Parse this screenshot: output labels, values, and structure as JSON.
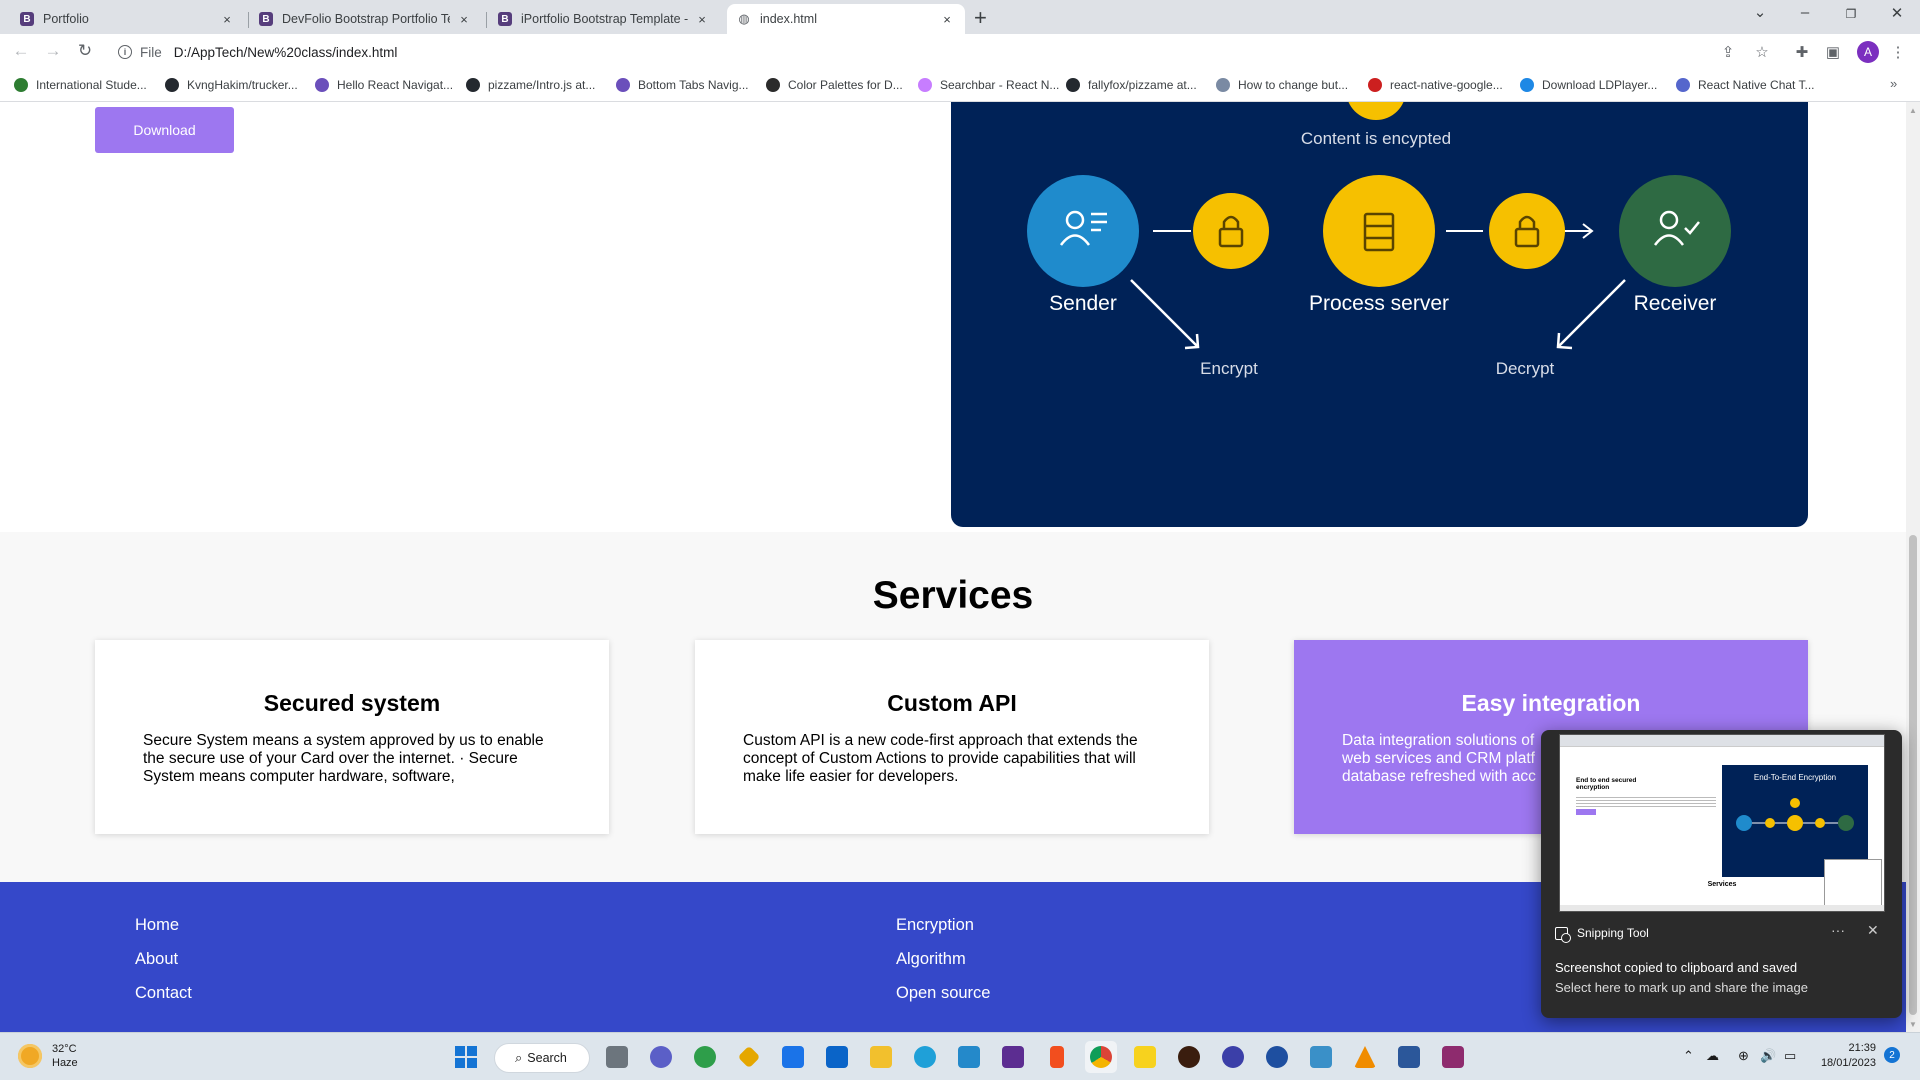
{
  "browser": {
    "tabs": [
      {
        "title": "Portfolio",
        "icon": "bootstrap-icon",
        "active": false
      },
      {
        "title": "DevFolio Bootstrap Portfolio Tem",
        "icon": "bootstrap-icon",
        "active": false
      },
      {
        "title": "iPortfolio Bootstrap Template - Ir",
        "icon": "bootstrap-icon",
        "active": false
      },
      {
        "title": "index.html",
        "icon": "globe-icon",
        "active": true
      }
    ],
    "tab_close_glyph": "×",
    "new_tab_glyph": "+",
    "omnibox": {
      "scheme": "File",
      "url": "D:/AppTech/New%20class/index.html"
    },
    "profile_initial": "A",
    "bookmarks": [
      {
        "label": "International Stude...",
        "color": "#2e7d32"
      },
      {
        "label": "KvngHakim/trucker...",
        "color": "#24292f"
      },
      {
        "label": "Hello React Navigat...",
        "color": "#6b4fbb"
      },
      {
        "label": "pizzame/Intro.js at...",
        "color": "#24292f"
      },
      {
        "label": "Bottom Tabs Navig...",
        "color": "#6b4fbb"
      },
      {
        "label": "Color Palettes for D...",
        "color": "#2b2b2b"
      },
      {
        "label": "Searchbar - React N...",
        "color": "#c77dff"
      },
      {
        "label": "fallyfox/pizzame at...",
        "color": "#24292f"
      },
      {
        "label": "How to change but...",
        "color": "#7a8aa3"
      },
      {
        "label": "react-native-google...",
        "color": "#cc1f1f"
      },
      {
        "label": "Download LDPlayer...",
        "color": "#1e88e5"
      },
      {
        "label": "React Native Chat T...",
        "color": "#5566cc"
      }
    ],
    "bookmarks_more": "»"
  },
  "page": {
    "download_label": "Download",
    "diagram": {
      "caption": "Content is encypted",
      "nodes": [
        "Sender",
        "Process server",
        "Receiver"
      ],
      "steps": [
        "Encrypt",
        "Decrypt"
      ],
      "colors": {
        "background": "#002257",
        "sender": "#1f8bcc",
        "server": "#f6c000",
        "receiver": "#2e6a43",
        "lock": "#f6c000"
      }
    },
    "services_title": "Services",
    "services": [
      {
        "title": "Secured system",
        "text": "Secure System means a system approved by us to enable the secure use of your Card over the internet. · Secure System means computer hardware, software,"
      },
      {
        "title": "Custom API",
        "text": "Custom API is a new code-first approach that extends the concept of Custom Actions to provide capabilities that will make life easier for developers."
      },
      {
        "title": "Easy integration",
        "text": "Data integration solutions of web services and CRM platf database refreshed with acc"
      }
    ],
    "footer_col1": [
      "Home",
      "About",
      "Contact"
    ],
    "footer_col2": [
      "Encryption",
      "Algorithm",
      "Open source"
    ],
    "colors": {
      "accent": "#9d77f0",
      "footer": "#3548c9"
    }
  },
  "toast": {
    "app_name": "Snipping Tool",
    "more_glyph": "···",
    "close_glyph": "✕",
    "message": "Screenshot copied to clipboard and saved",
    "sub": "Select here to mark up and share the image",
    "preview": {
      "heading": "End to end secured encryption",
      "diagram_title": "End-To-End Encryption",
      "services": "Services"
    }
  },
  "taskbar": {
    "weather_temp": "32°C",
    "weather_desc": "Haze",
    "search_label": "Search",
    "time": "21:39",
    "date": "18/01/2023",
    "notification_count": "2"
  }
}
